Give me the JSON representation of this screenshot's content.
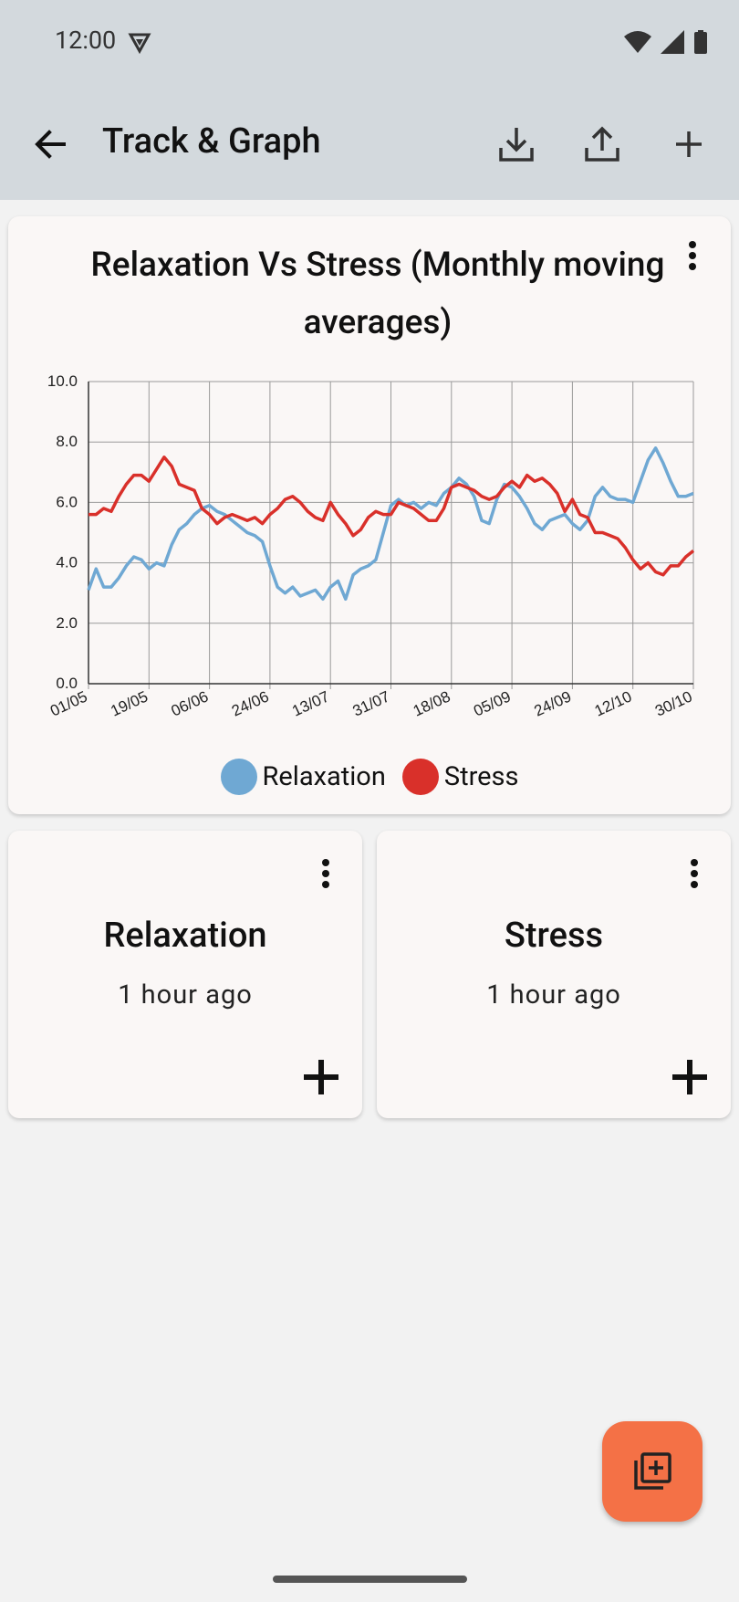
{
  "status_bar": {
    "time": "12:00"
  },
  "app_bar": {
    "title": "Track & Graph"
  },
  "graph": {
    "title": "Relaxation Vs Stress (Monthly moving averages)"
  },
  "chart_data": {
    "type": "line",
    "title": "Relaxation Vs Stress (Monthly moving averages)",
    "ylim": [
      0,
      10
    ],
    "yticks": [
      "0.0",
      "2.0",
      "4.0",
      "6.0",
      "8.0",
      "10.0"
    ],
    "xticks": [
      "01/05",
      "19/05",
      "06/06",
      "24/06",
      "13/07",
      "31/07",
      "18/08",
      "05/09",
      "24/09",
      "12/10",
      "30/10"
    ],
    "grid": true,
    "legend": "bottom-center",
    "series": [
      {
        "name": "Relaxation",
        "color": "#6fa8d3",
        "values": [
          3.1,
          3.8,
          3.2,
          3.2,
          3.5,
          3.9,
          4.2,
          4.1,
          3.8,
          4.0,
          3.9,
          4.6,
          5.1,
          5.3,
          5.6,
          5.8,
          5.9,
          5.7,
          5.6,
          5.4,
          5.2,
          5.0,
          4.9,
          4.7,
          3.9,
          3.2,
          3.0,
          3.2,
          2.9,
          3.0,
          3.1,
          2.8,
          3.2,
          3.4,
          2.8,
          3.6,
          3.8,
          3.9,
          4.1,
          5.0,
          5.9,
          6.1,
          5.9,
          6.0,
          5.8,
          6.0,
          5.9,
          6.3,
          6.5,
          6.8,
          6.6,
          6.2,
          5.4,
          5.3,
          6.1,
          6.6,
          6.5,
          6.2,
          5.8,
          5.3,
          5.1,
          5.4,
          5.5,
          5.6,
          5.3,
          5.1,
          5.4,
          6.2,
          6.5,
          6.2,
          6.1,
          6.1,
          6.0,
          6.7,
          7.4,
          7.8,
          7.3,
          6.7,
          6.2,
          6.2,
          6.3
        ]
      },
      {
        "name": "Stress",
        "color": "#d9302a",
        "values": [
          5.6,
          5.6,
          5.8,
          5.7,
          6.2,
          6.6,
          6.9,
          6.9,
          6.7,
          7.1,
          7.5,
          7.2,
          6.6,
          6.5,
          6.4,
          5.8,
          5.6,
          5.3,
          5.5,
          5.6,
          5.5,
          5.4,
          5.5,
          5.3,
          5.6,
          5.8,
          6.1,
          6.2,
          6.0,
          5.7,
          5.5,
          5.4,
          6.0,
          5.6,
          5.3,
          4.9,
          5.1,
          5.5,
          5.7,
          5.6,
          5.6,
          6.0,
          5.9,
          5.8,
          5.6,
          5.4,
          5.4,
          5.8,
          6.5,
          6.6,
          6.5,
          6.4,
          6.2,
          6.1,
          6.2,
          6.5,
          6.7,
          6.5,
          6.9,
          6.7,
          6.8,
          6.6,
          6.3,
          5.7,
          6.1,
          5.6,
          5.5,
          5.0,
          5.0,
          4.9,
          4.8,
          4.5,
          4.1,
          3.8,
          4.0,
          3.7,
          3.6,
          3.9,
          3.9,
          4.2,
          4.4
        ]
      }
    ]
  },
  "trackers": [
    {
      "name": "Relaxation",
      "last_logged": "1 hour ago"
    },
    {
      "name": "Stress",
      "last_logged": "1 hour ago"
    }
  ],
  "icons": {
    "back": "arrow-left-icon",
    "import": "download-icon",
    "export": "upload-icon",
    "add": "plus-icon",
    "fab": "add-to-library-icon"
  }
}
